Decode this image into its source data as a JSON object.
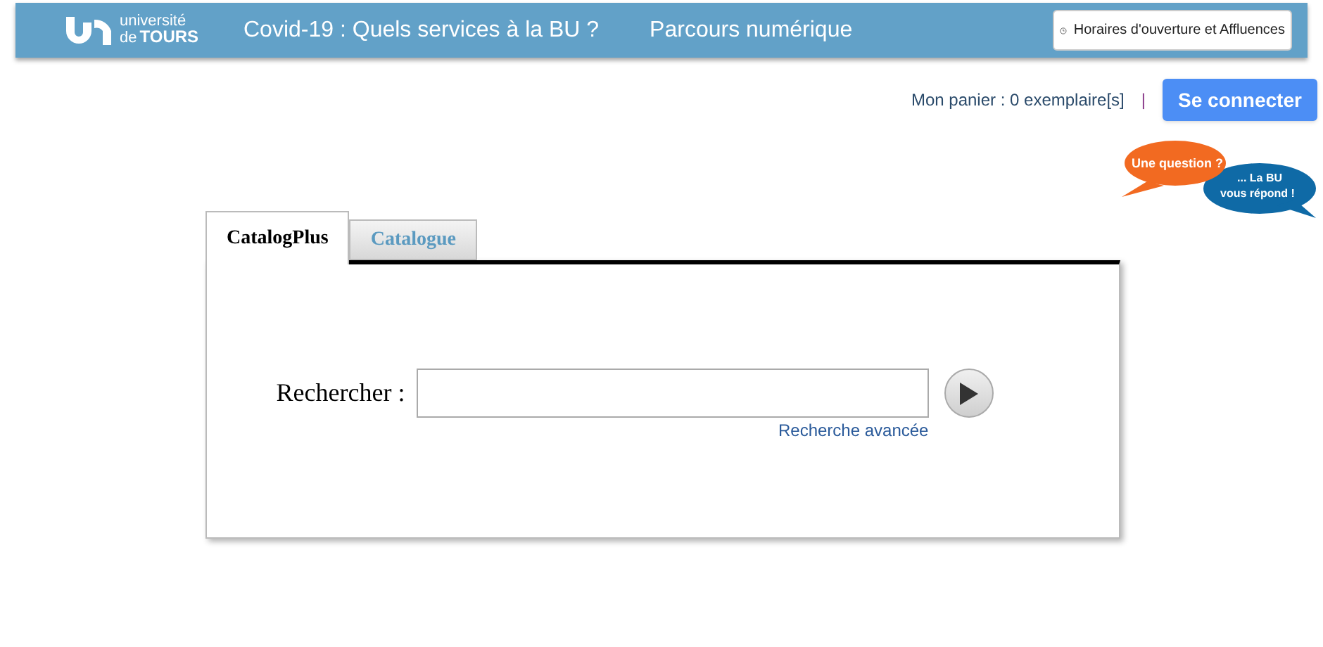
{
  "header": {
    "logo": {
      "line1": "université",
      "line2_prefix": "de",
      "line2_main": "TOURS"
    },
    "nav": [
      "Covid-19 : Quels services à la BU ?",
      "Parcours numérique"
    ],
    "hours_button": "Horaires d'ouverture et Affluences"
  },
  "account": {
    "cart": "Mon panier : 0 exemplaire[s]",
    "separator": "|",
    "login": "Se connecter"
  },
  "chat_badge": {
    "question": "Une question ?",
    "answer_line1": "... La BU",
    "answer_line2": "vous répond !"
  },
  "search": {
    "tabs": [
      {
        "label": "CatalogPlus",
        "selected": true
      },
      {
        "label": "Catalogue",
        "selected": false
      }
    ],
    "label": "Rechercher :",
    "advanced_link": "Recherche avancée"
  }
}
